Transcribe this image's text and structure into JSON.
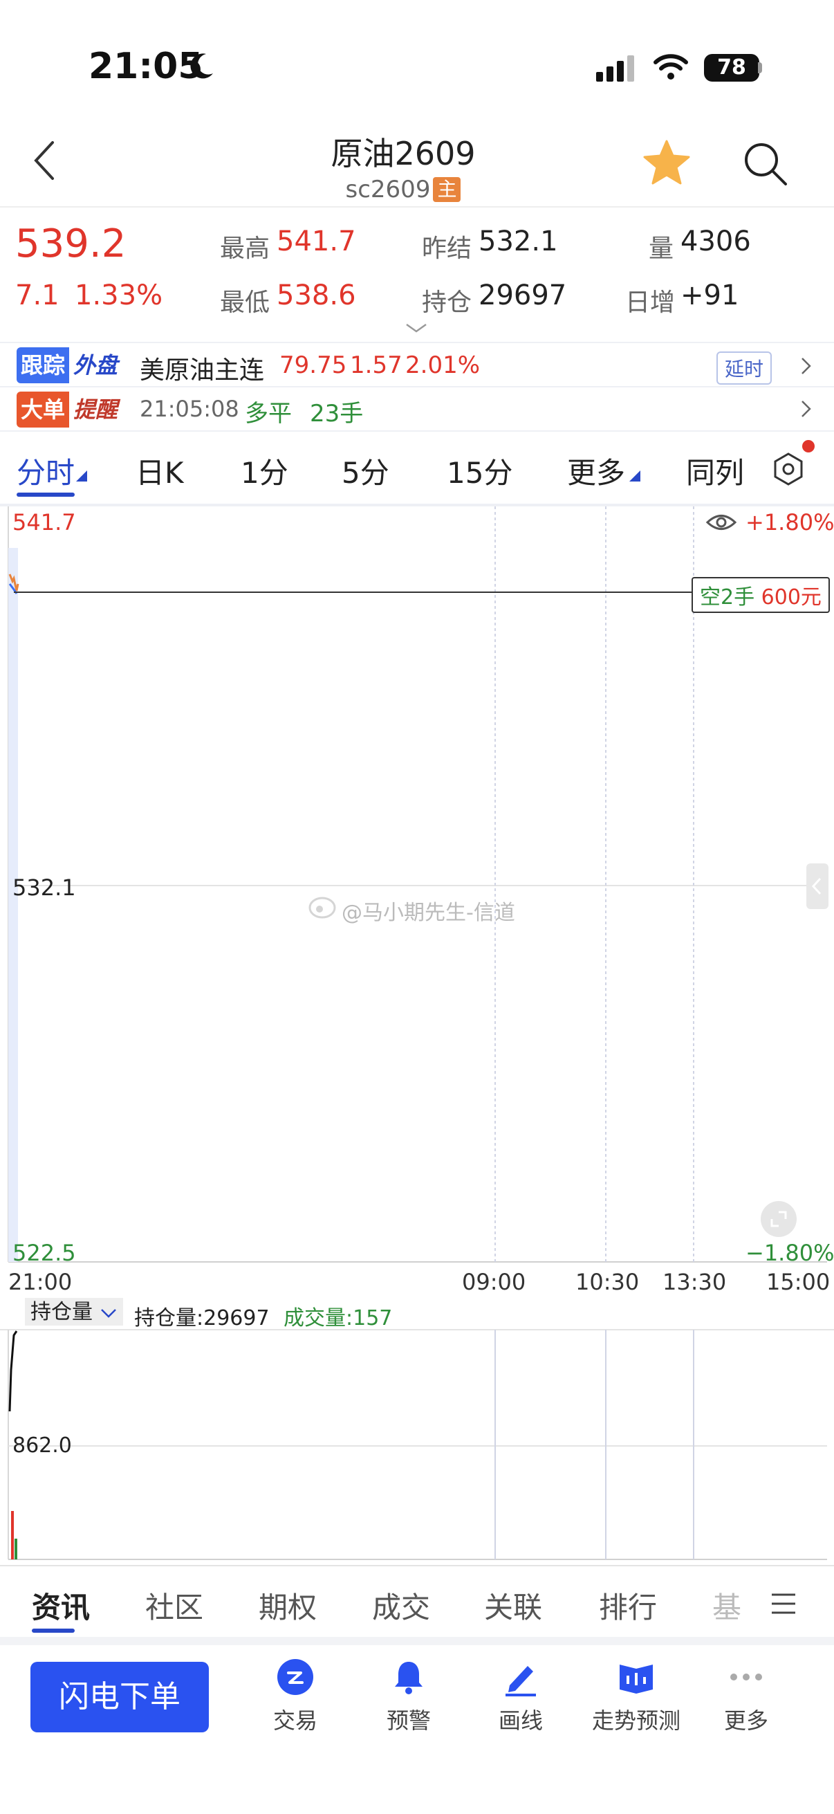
{
  "status": {
    "time": "21:05",
    "battery": "78"
  },
  "header": {
    "title": "原油2609",
    "subtitle": "sc2609",
    "badge": "主"
  },
  "quote": {
    "price": "539.2",
    "change": "7.1",
    "change_pct": "1.33%",
    "high_label": "最高",
    "high": "541.7",
    "low_label": "最低",
    "low": "538.6",
    "prev_settle_label": "昨结",
    "prev_settle": "532.1",
    "open_interest_label": "持仓",
    "open_interest": "29697",
    "volume_label": "量",
    "volume": "4306",
    "daily_incr_label": "日增",
    "daily_incr": "+91"
  },
  "follow_bar": {
    "tag1": "跟踪",
    "tag2": "外盘",
    "name": "美原油主连",
    "price": "79.75",
    "change": "1.57",
    "pct": "2.01%",
    "delay_label": "延时"
  },
  "alert_bar": {
    "tag1": "大单",
    "tag2": "提醒",
    "time": "21:05:08",
    "action": "多平",
    "qty": "23手"
  },
  "chart_tabs": [
    "分时",
    "日K",
    "1分",
    "5分",
    "15分",
    "更多",
    "同列"
  ],
  "chart": {
    "y_top": "541.7",
    "y_mid": "532.1",
    "y_bottom": "522.5",
    "pct_top": "+1.80%",
    "pct_bottom": "−1.80%",
    "position_tag_side": "空2手",
    "position_tag_value": "600元",
    "watermark": "@马小期先生-信道",
    "times": [
      "21:00",
      "09:00",
      "10:30",
      "13:30",
      "15:00"
    ]
  },
  "sub_chart": {
    "selector": "持仓量",
    "oi_label": "持仓量:29697",
    "vol_label": "成交量:157",
    "y_label": "862.0"
  },
  "chart_data": {
    "type": "line",
    "title": "",
    "xlabel": "",
    "ylabel": "",
    "x": [
      "21:00",
      "09:00",
      "10:30",
      "13:30",
      "15:00"
    ],
    "ylim": [
      522.5,
      541.7
    ],
    "series": [],
    "reference_line": 532.1,
    "grid": true,
    "legend": "none"
  },
  "bottom_tabs": [
    "资讯",
    "社区",
    "期权",
    "成交",
    "关联",
    "排行",
    "基"
  ],
  "actions": {
    "order_button": "闪电下单",
    "items": [
      {
        "label": "交易",
        "icon": "trade-icon"
      },
      {
        "label": "预警",
        "icon": "bell-icon"
      },
      {
        "label": "画线",
        "icon": "draw-icon"
      },
      {
        "label": "走势预测",
        "icon": "forecast-icon"
      },
      {
        "label": "更多",
        "icon": "more-dots-icon"
      }
    ]
  },
  "colors": {
    "up": "#e0352b",
    "down": "#2f8f3a",
    "accent": "#2848c8",
    "order_button": "#2a52f0",
    "star": "#f7b34a"
  }
}
